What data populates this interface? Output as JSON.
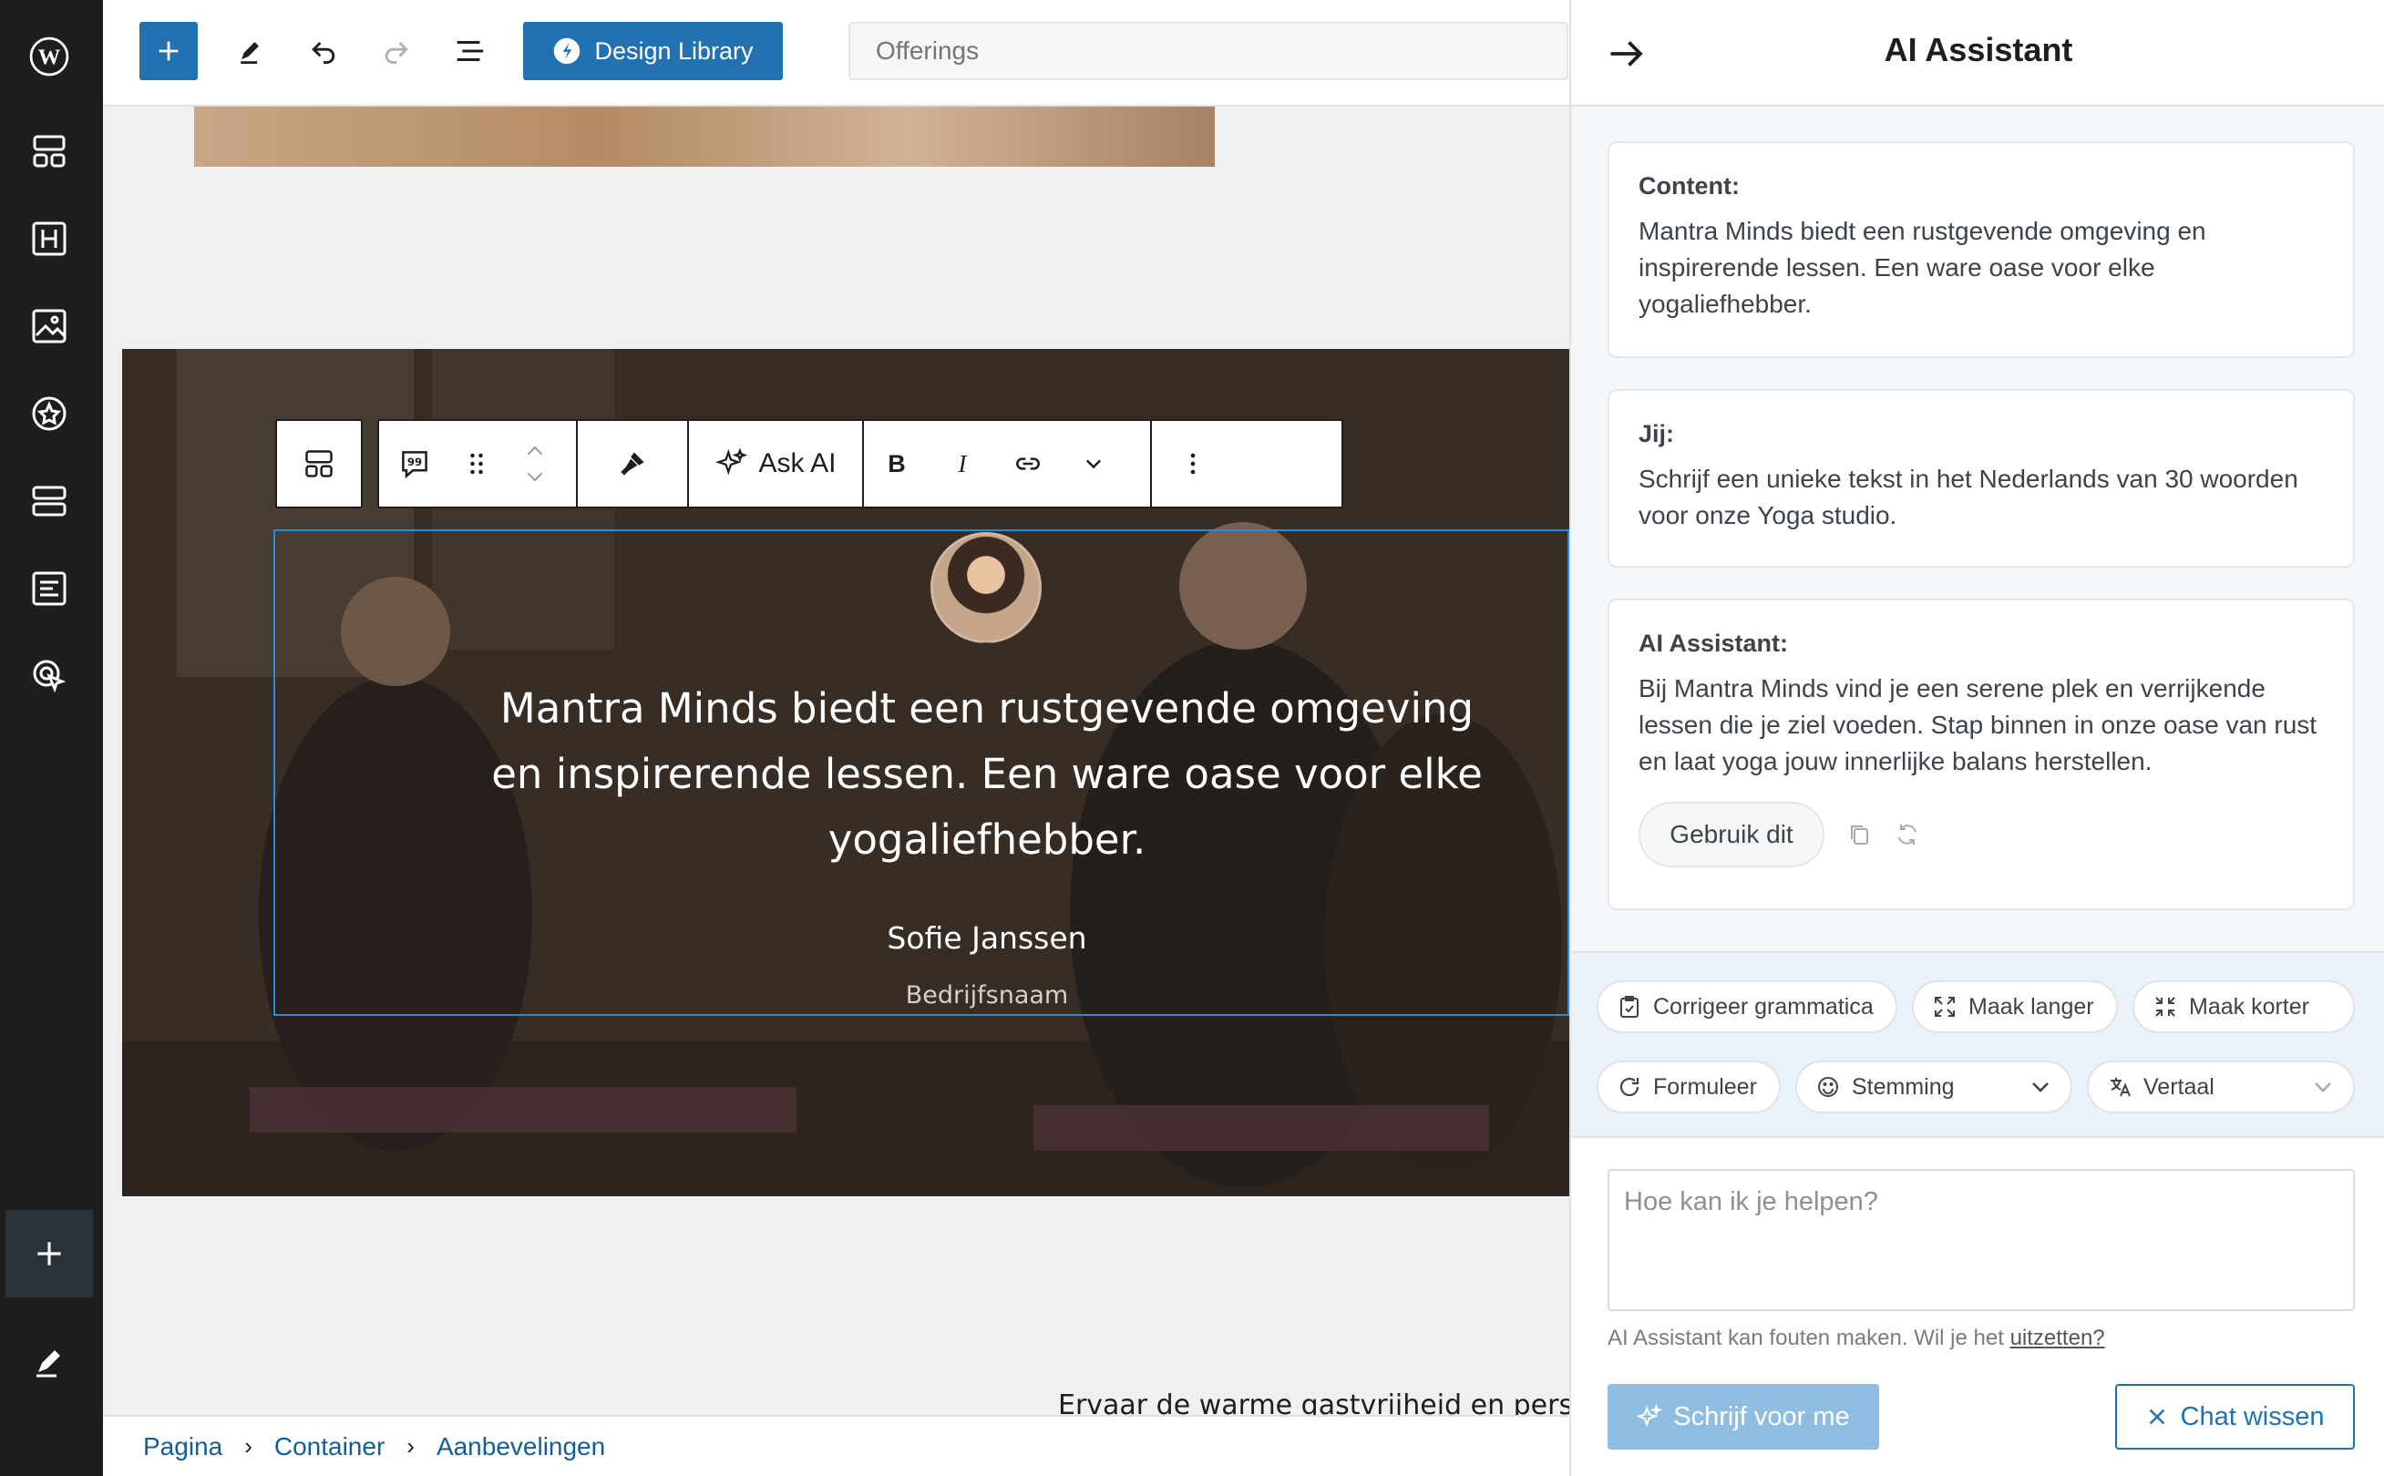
{
  "topbar": {
    "design_library_label": "Design Library",
    "document_title": "Offerings"
  },
  "block": {
    "ask_ai_label": "Ask AI",
    "quote_text": "Mantra Minds biedt een rustgevende omgeving en inspirerende lessen. Een ware oase voor elke yogaliefhebber.",
    "author_name": "Sofie Janssen",
    "company": "Bedrijfsnaam"
  },
  "below": {
    "text": "Ervaar de warme gastvrijheid en persoonli"
  },
  "breadcrumb": [
    "Pagina",
    "Container",
    "Aanbevelingen"
  ],
  "panel": {
    "title": "AI Assistant",
    "messages": [
      {
        "label": "Content:",
        "text": "Mantra Minds biedt een rustgevende omgeving en inspirerende lessen. Een ware oase voor elke yogaliefhebber."
      },
      {
        "label": "Jij:",
        "text": "Schrijf een unieke tekst in het Nederlands van 30 woorden voor onze Yoga studio."
      },
      {
        "label": "AI Assistant:",
        "text": "Bij Mantra Minds vind je een serene plek en verrijkende lessen die je ziel voeden. Stap binnen in onze oase van rust en laat yoga jouw innerlijke balans herstellen."
      }
    ],
    "use_this_label": "Gebruik dit",
    "actions": {
      "grammar": "Corrigeer grammatica",
      "longer": "Maak langer",
      "shorter": "Maak korter",
      "rephrase": "Formuleer",
      "tone": "Stemming",
      "translate": "Vertaal"
    },
    "prompt_placeholder": "Hoe kan ik je helpen?",
    "disclaimer": "AI Assistant kan fouten maken. Wil je het",
    "disclaimer_link": "uitzetten?",
    "write_button": "Schrijf voor me",
    "clear_button": "Chat wissen"
  },
  "colors": {
    "accent": "#2271b1",
    "sidebar": "#1e1e1e",
    "selection": "#2c8ad6"
  }
}
